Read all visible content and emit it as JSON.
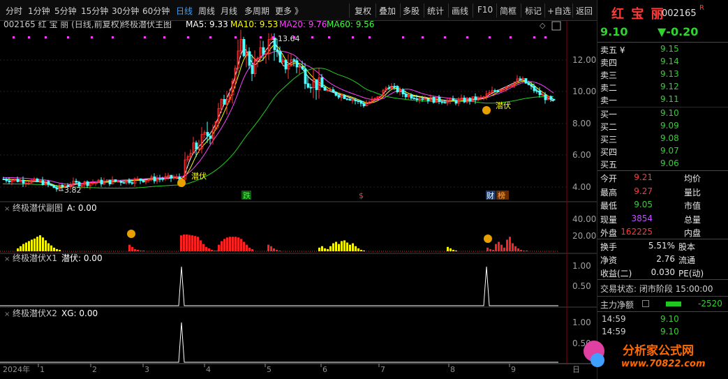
{
  "toolbar": {
    "periods": [
      "分时",
      "1分钟",
      "5分钟",
      "15分钟",
      "30分钟",
      "60分钟",
      "日线",
      "周线",
      "月线",
      "多周期",
      "更多 》"
    ],
    "active_period": "日线",
    "tools": [
      "复权",
      "叠加",
      "多股",
      "统计",
      "画线",
      "F10",
      "简框",
      "标记",
      "+自选",
      "返回"
    ]
  },
  "main_panel": {
    "code_name": "002165 红 宝 丽 (日线,前复权)",
    "indicator_name": "终极潜伏主图",
    "ma5": "MA5: 9.33",
    "ma10": "MA10: 9.53",
    "ma20": "MA20: 9.76",
    "ma60": "MA60: 9.56",
    "high_label": "13.64",
    "low_label": "3.82",
    "signal_label": "潜伏",
    "y_ticks": [
      "12.00",
      "10.00",
      "8.00",
      "6.00",
      "4.00"
    ],
    "events": [
      "跌",
      "$",
      "财",
      "榜"
    ]
  },
  "sub1": {
    "title": "终极潜伏副图",
    "value": "A: 0.00",
    "y_ticks": [
      "40.00",
      "20.00"
    ]
  },
  "sub2": {
    "title": "终极潜伏X1",
    "value": "潜伏: 0.00",
    "y_ticks": [
      "1.00",
      "0.50"
    ]
  },
  "sub3": {
    "title": "终极潜伏X2",
    "value": "XG: 0.00",
    "y_ticks": [
      "1.00",
      "0.50"
    ]
  },
  "x_axis": {
    "year": "2024年",
    "months": [
      "1",
      "2",
      "3",
      "4",
      "5",
      "6",
      "7",
      "8",
      "9"
    ],
    "right_label": "日"
  },
  "quote": {
    "name": "红 宝 丽",
    "code": "002165",
    "flag": "R",
    "price": "9.10",
    "change": "▼-0.20",
    "sell": [
      {
        "label": "卖五 ¥",
        "price": "9.15",
        "vol": ""
      },
      {
        "label": "卖四",
        "price": "9.14",
        "vol": ""
      },
      {
        "label": "卖三",
        "price": "9.13",
        "vol": ""
      },
      {
        "label": "卖二",
        "price": "9.12",
        "vol": ""
      },
      {
        "label": "卖一",
        "price": "9.11",
        "vol": ""
      }
    ],
    "buy": [
      {
        "label": "买一",
        "price": "9.10",
        "vol": ""
      },
      {
        "label": "买二",
        "price": "9.09",
        "vol": ""
      },
      {
        "label": "买三",
        "price": "9.08",
        "vol": ""
      },
      {
        "label": "买四",
        "price": "9.07",
        "vol": ""
      },
      {
        "label": "买五",
        "price": "9.06",
        "vol": ""
      }
    ],
    "stats_left": [
      {
        "label": "今开",
        "value": "9.21"
      },
      {
        "label": "最高",
        "value": "9.27"
      },
      {
        "label": "最低",
        "value": "9.05"
      },
      {
        "label": "现量",
        "value": "3854"
      },
      {
        "label": "外盘",
        "value": "162225"
      }
    ],
    "stats_right": [
      "均价",
      "量比",
      "市值",
      "总量",
      "内盘"
    ],
    "fund_rows": [
      {
        "label": "换手",
        "value": "5.51%",
        "right": "股本"
      },
      {
        "label": "净资",
        "value": "2.76",
        "right": "流通"
      },
      {
        "label": "收益(二)",
        "value": "0.030",
        "right": "PE(动)"
      }
    ],
    "trade_status": "交易状态: 闭市阶段 15:00:00",
    "main_flow_label": "主力净额",
    "main_flow_value": "-2520",
    "ticks": [
      {
        "time": "14:59",
        "price": "9.10"
      },
      {
        "time": "14:59",
        "price": "9.10"
      }
    ]
  },
  "watermark": {
    "text": "分析家公式网",
    "url": "www.70822.com"
  }
}
